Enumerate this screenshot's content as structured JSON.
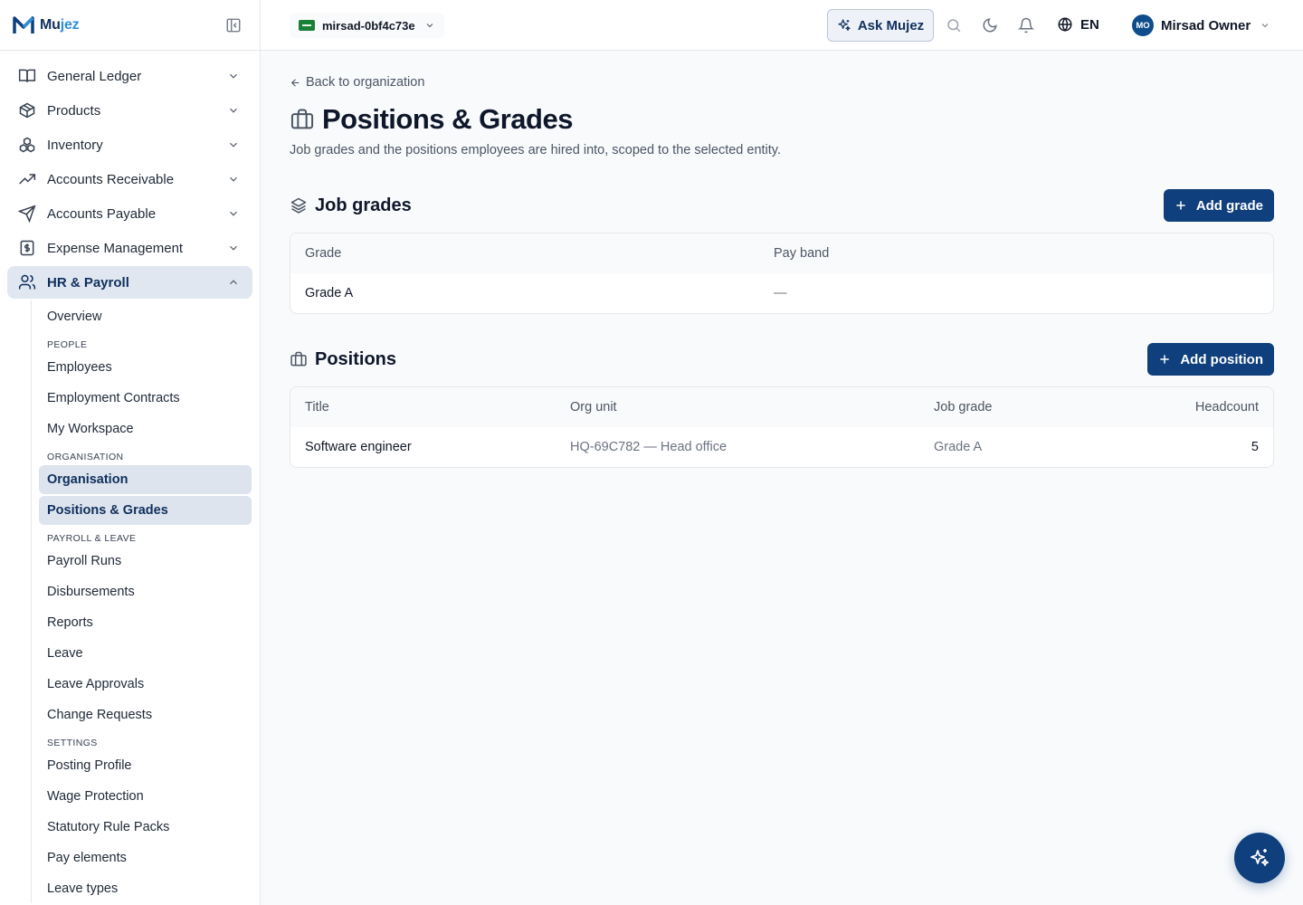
{
  "brand": {
    "name_part1": "Mu",
    "name_part2": "jez",
    "accent_color": "#2d8fd8",
    "primary_color": "#0f3f7c"
  },
  "topbar": {
    "entity_name": "mirsad-0bf4c73e",
    "ask_label": "Ask Mujez",
    "language": "EN",
    "user_initials": "MO",
    "user_name": "Mirsad Owner"
  },
  "sidebar": {
    "items": [
      {
        "label": "General Ledger",
        "icon": "book-open-icon"
      },
      {
        "label": "Products",
        "icon": "package-icon"
      },
      {
        "label": "Inventory",
        "icon": "boxes-icon"
      },
      {
        "label": "Accounts Receivable",
        "icon": "trending-up-icon"
      },
      {
        "label": "Accounts Payable",
        "icon": "send-icon"
      },
      {
        "label": "Expense Management",
        "icon": "receipt-dollar-icon"
      },
      {
        "label": "HR & Payroll",
        "icon": "users-icon"
      }
    ],
    "hr_sub": {
      "overview": "Overview",
      "people_header": "PEOPLE",
      "employees": "Employees",
      "contracts": "Employment Contracts",
      "workspace": "My Workspace",
      "org_header": "ORGANISATION",
      "organisation": "Organisation",
      "positions": "Positions & Grades",
      "payroll_header": "PAYROLL & LEAVE",
      "payroll_runs": "Payroll Runs",
      "disbursements": "Disbursements",
      "reports": "Reports",
      "leave": "Leave",
      "leave_approvals": "Leave Approvals",
      "change_requests": "Change Requests",
      "settings_header": "SETTINGS",
      "posting_profile": "Posting Profile",
      "wage_protection": "Wage Protection",
      "statutory": "Statutory Rule Packs",
      "pay_elements": "Pay elements",
      "leave_types": "Leave types"
    }
  },
  "page": {
    "back_label": "Back to organization",
    "title": "Positions & Grades",
    "description": "Job grades and the positions employees are hired into, scoped to the selected entity."
  },
  "grades": {
    "title": "Job grades",
    "add_label": "Add grade",
    "columns": {
      "grade": "Grade",
      "pay_band": "Pay band"
    },
    "rows": [
      {
        "grade": "Grade A",
        "pay_band": "—"
      }
    ]
  },
  "positions": {
    "title": "Positions",
    "add_label": "Add position",
    "columns": {
      "title": "Title",
      "org_unit": "Org unit",
      "job_grade": "Job grade",
      "headcount": "Headcount"
    },
    "rows": [
      {
        "title": "Software engineer",
        "org_unit": "HQ-69C782 — Head office",
        "job_grade": "Grade A",
        "headcount": "5"
      }
    ]
  }
}
